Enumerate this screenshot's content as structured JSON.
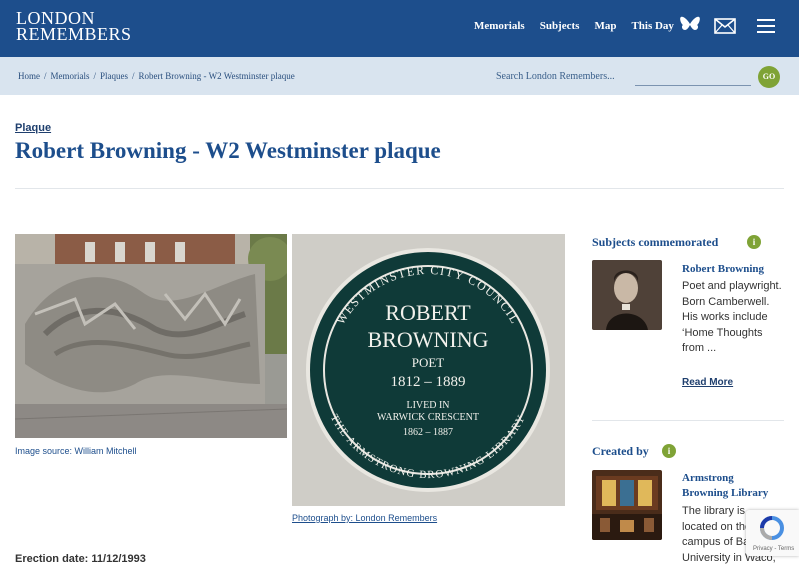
{
  "header": {
    "logo_line1": "LONDON",
    "logo_line2": "REMEMBERS",
    "nav": [
      "Memorials",
      "Subjects",
      "Map",
      "This Day"
    ]
  },
  "breadcrumb": [
    "Home",
    "Memorials",
    "Plaques",
    "Robert Browning - W2 Westminster plaque"
  ],
  "search": {
    "placeholder": "Search London Remembers...",
    "go_label": "GO"
  },
  "page": {
    "type_label": "Plaque",
    "title": "Robert Browning - W2 Westminster plaque",
    "image1_caption": "Image source: William Mitchell",
    "image2_caption": "Photograph by: London Remembers",
    "erection_date": "Erection date: 11/12/1993"
  },
  "plaque": {
    "top_arc": "WESTMINSTER CITY COUNCIL",
    "line1": "ROBERT",
    "line2": "BROWNING",
    "line3": "POET",
    "line4": "1812 – 1889",
    "line5": "LIVED IN",
    "line6": "WARWICK CRESCENT",
    "line7": "1862 – 1887",
    "bottom_arc": "THE ARMSTRONG BROWNING LIBRARY"
  },
  "sidebar": {
    "subjects_heading": "Subjects commemorated",
    "subject_name": "Robert Browning",
    "subject_desc": "Poet and playwright. Born Camberwell.  His works include ‘Home Thoughts from ...",
    "read_more": "Read More",
    "created_heading": "Created by",
    "creator_name": "Armstrong Browning Library",
    "creator_desc": "The library is located on the campus of Baylor University in Waco,",
    "info_glyph": "i"
  },
  "recaptcha": {
    "text": "Privacy - Terms"
  },
  "colors": {
    "brand": "#1d4e8c",
    "accent": "#7fa336",
    "crumb_bg": "#d9e4ef"
  }
}
